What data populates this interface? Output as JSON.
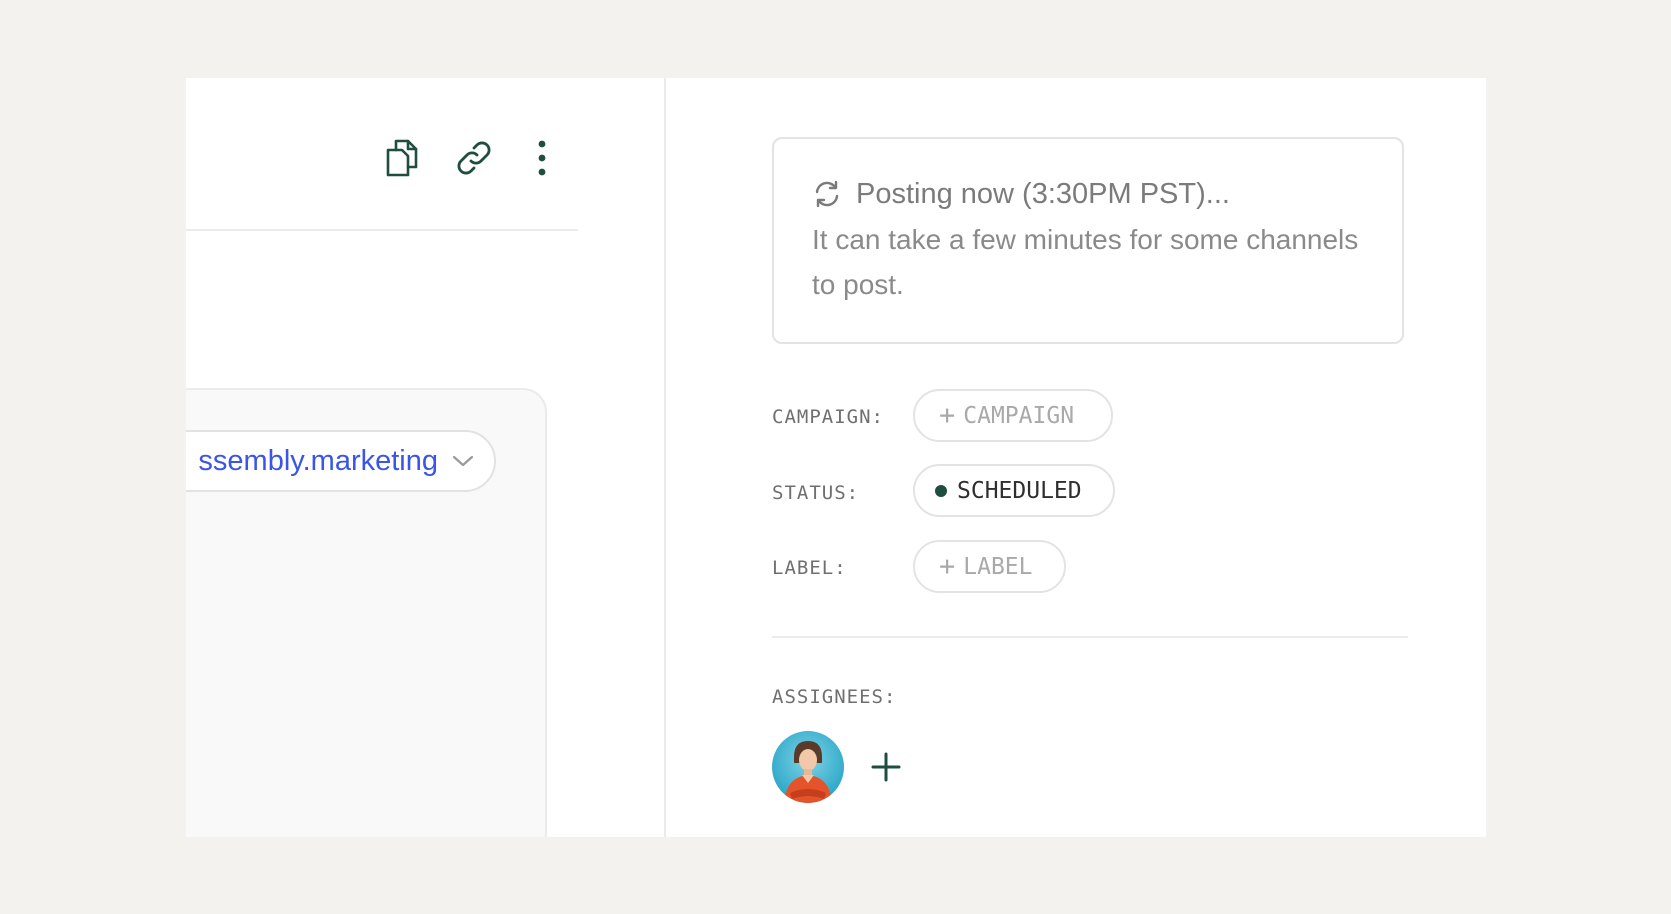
{
  "toolbar": {
    "icons": [
      "copy-icon",
      "link-icon",
      "more-vertical-icon"
    ],
    "icon_color": "#1f4d40"
  },
  "preview": {
    "domain_text": "ssembly.marketing",
    "domain_color": "#3b55e6"
  },
  "status_box": {
    "title": "Posting now (3:30PM PST)...",
    "description": "It can take a few minutes for some channels to post."
  },
  "meta": {
    "campaign_label": "CAMPAIGN:",
    "campaign_chip": "CAMPAIGN",
    "status_label": "STATUS:",
    "status_value": "SCHEDULED",
    "status_dot_color": "#1f4d40",
    "label_label": "LABEL:",
    "label_chip": "LABEL",
    "assignees_label": "ASSIGNEES:"
  },
  "plus_glyph": "+"
}
